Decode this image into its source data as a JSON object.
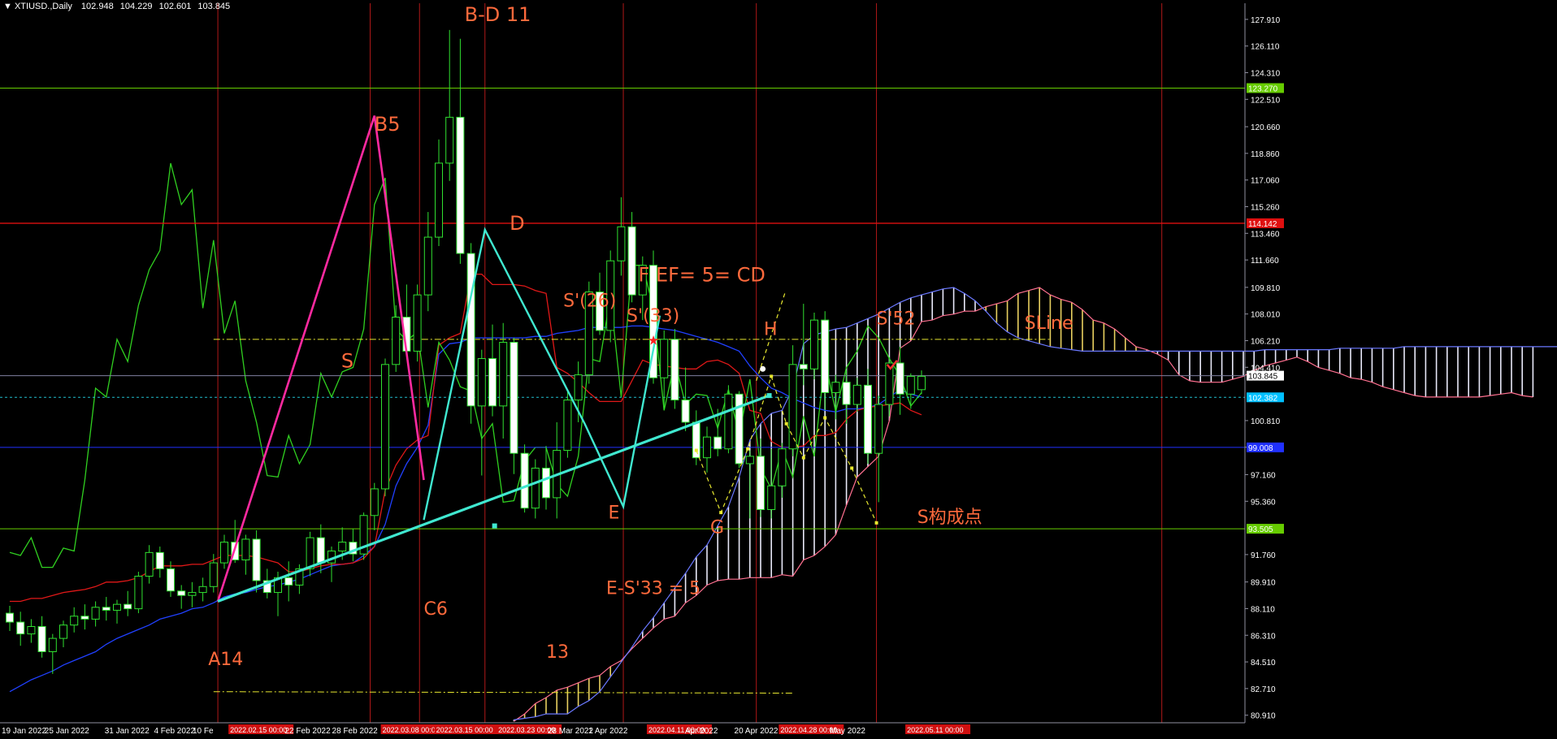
{
  "header": {
    "symbol": "XTIUSD.,Daily",
    "open": "102.948",
    "high": "104.229",
    "low": "102.601",
    "close": "103.845"
  },
  "chart_data": {
    "type": "candlestick",
    "symbol": "XTIUSD.",
    "timeframe": "Daily",
    "ylim": [
      80.4,
      129.0
    ],
    "y_ticks": [
      "127.910",
      "126.110",
      "124.310",
      "122.510",
      "120.660",
      "118.860",
      "117.060",
      "115.260",
      "113.460",
      "111.660",
      "109.810",
      "108.010",
      "106.210",
      "104.410",
      "103.845",
      "102.382",
      "100.810",
      "99.010",
      "97.160",
      "95.360",
      "93.505",
      "91.760",
      "89.910",
      "88.110",
      "86.310",
      "84.510",
      "82.710",
      "80.910"
    ],
    "x_labels": [
      "19 Jan 2022",
      "25 Jan 2022",
      "31 Jan 2022",
      "4 Feb 2022",
      "10 Fe",
      "2022.02.15 00:00",
      "22 Feb 2022",
      "28 Feb 2022",
      "2022.03.08 00:00",
      "2022.03.15 00:00",
      "2022.03.23 00:00",
      "28 Mar 2022",
      "1 Apr 2022",
      "2022.04.11 00:00",
      "Apr 2022",
      "20 Apr 2022",
      "2022.04.28 00:00",
      "May 2022",
      "2022.05.11 00:00"
    ],
    "x_label_kinds": [
      "axis",
      "axis",
      "axis",
      "axis",
      "axis",
      "marker",
      "axis",
      "axis",
      "marker",
      "marker",
      "marker",
      "axis",
      "axis",
      "marker",
      "axis",
      "axis",
      "marker",
      "axis",
      "marker"
    ],
    "price_tags": [
      {
        "label": "123.270",
        "value": 123.27,
        "color": "#66cc00"
      },
      {
        "label": "114.142",
        "value": 114.14,
        "color": "#e01010"
      },
      {
        "label": "103.845",
        "value": 103.845,
        "color": "#ffffff"
      },
      {
        "label": "102.382",
        "value": 102.38,
        "color": "#00c0ff"
      },
      {
        "label": "99.008",
        "value": 99.0,
        "color": "#2030ff"
      },
      {
        "label": "93.505",
        "value": 93.5,
        "color": "#66cc00"
      }
    ],
    "candles": [
      [
        87.8,
        88.3,
        86.6,
        87.2
      ],
      [
        87.2,
        87.9,
        85.6,
        86.4
      ],
      [
        86.4,
        87.4,
        85.8,
        86.9
      ],
      [
        86.9,
        87.6,
        84.8,
        85.2
      ],
      [
        85.2,
        86.4,
        83.7,
        86.1
      ],
      [
        86.1,
        87.3,
        85.5,
        87.0
      ],
      [
        87.0,
        88.2,
        86.5,
        87.6
      ],
      [
        87.6,
        88.4,
        86.7,
        87.4
      ],
      [
        87.4,
        88.6,
        86.9,
        88.2
      ],
      [
        88.2,
        88.9,
        87.3,
        88.0
      ],
      [
        88.0,
        88.7,
        87.1,
        88.4
      ],
      [
        88.4,
        89.3,
        87.6,
        88.1
      ],
      [
        88.1,
        90.6,
        87.8,
        90.3
      ],
      [
        90.3,
        92.4,
        89.8,
        91.9
      ],
      [
        91.9,
        92.3,
        90.2,
        90.8
      ],
      [
        90.8,
        91.3,
        88.9,
        89.3
      ],
      [
        89.3,
        89.7,
        88.1,
        89.0
      ],
      [
        89.0,
        89.9,
        88.2,
        89.2
      ],
      [
        89.2,
        90.2,
        88.6,
        89.6
      ],
      [
        89.6,
        91.8,
        89.2,
        91.2
      ],
      [
        91.2,
        93.1,
        90.8,
        92.6
      ],
      [
        92.6,
        94.1,
        91.2,
        91.4
      ],
      [
        91.4,
        93.1,
        90.4,
        92.8
      ],
      [
        92.8,
        93.4,
        89.2,
        90.0
      ],
      [
        90.0,
        90.8,
        88.8,
        89.2
      ],
      [
        89.2,
        90.6,
        87.6,
        90.2
      ],
      [
        90.2,
        91.3,
        88.6,
        89.7
      ],
      [
        89.7,
        91.1,
        89.1,
        90.8
      ],
      [
        90.8,
        93.3,
        90.3,
        92.9
      ],
      [
        92.9,
        93.8,
        90.5,
        91.2
      ],
      [
        91.2,
        92.3,
        89.9,
        92.0
      ],
      [
        92.0,
        93.6,
        91.4,
        92.6
      ],
      [
        92.6,
        93.5,
        91.3,
        91.8
      ],
      [
        91.8,
        94.6,
        91.4,
        94.4
      ],
      [
        94.4,
        96.6,
        93.4,
        96.2
      ],
      [
        96.2,
        105.0,
        95.7,
        104.6
      ],
      [
        104.6,
        108.6,
        104.1,
        107.8
      ],
      [
        107.8,
        110.0,
        105.2,
        105.5
      ],
      [
        105.5,
        110.0,
        104.8,
        109.3
      ],
      [
        109.3,
        114.9,
        108.2,
        113.2
      ],
      [
        113.2,
        119.8,
        112.6,
        118.2
      ],
      [
        118.2,
        127.2,
        117.0,
        121.3
      ],
      [
        121.3,
        126.6,
        111.4,
        112.1
      ],
      [
        112.1,
        112.8,
        100.6,
        101.8
      ],
      [
        101.8,
        105.6,
        97.1,
        105.0
      ],
      [
        105.0,
        107.3,
        101.1,
        101.8
      ],
      [
        101.8,
        107.4,
        99.6,
        106.1
      ],
      [
        106.1,
        106.4,
        97.2,
        98.6
      ],
      [
        98.6,
        99.2,
        94.6,
        94.9
      ],
      [
        94.9,
        98.2,
        94.2,
        97.6
      ],
      [
        97.6,
        99.1,
        94.8,
        95.6
      ],
      [
        95.6,
        100.7,
        94.2,
        98.8
      ],
      [
        98.8,
        102.9,
        98.3,
        102.2
      ],
      [
        102.2,
        104.8,
        100.7,
        103.9
      ],
      [
        103.9,
        110.2,
        103.3,
        109.5
      ],
      [
        109.5,
        110.8,
        106.6,
        106.9
      ],
      [
        106.9,
        112.3,
        106.1,
        111.6
      ],
      [
        111.6,
        115.9,
        110.6,
        113.9
      ],
      [
        113.9,
        114.9,
        108.8,
        109.3
      ],
      [
        109.3,
        111.9,
        107.6,
        111.3
      ],
      [
        111.3,
        112.3,
        103.3,
        103.7
      ],
      [
        103.7,
        106.9,
        101.6,
        106.3
      ],
      [
        106.3,
        107.0,
        101.6,
        102.2
      ],
      [
        102.2,
        104.4,
        100.1,
        100.7
      ],
      [
        100.7,
        101.5,
        97.8,
        98.3
      ],
      [
        98.3,
        100.4,
        97.3,
        99.7
      ],
      [
        99.7,
        101.6,
        98.4,
        98.9
      ],
      [
        98.9,
        103.2,
        98.6,
        102.6
      ],
      [
        102.6,
        102.8,
        97.6,
        97.9
      ],
      [
        97.9,
        98.8,
        94.2,
        98.4
      ],
      [
        98.4,
        99.6,
        94.3,
        94.8
      ],
      [
        94.8,
        98.9,
        94.2,
        96.4
      ],
      [
        96.4,
        99.3,
        95.6,
        98.9
      ],
      [
        98.9,
        105.9,
        98.4,
        104.6
      ],
      [
        104.6,
        108.7,
        103.2,
        104.3
      ],
      [
        104.3,
        108.1,
        103.6,
        107.6
      ],
      [
        107.6,
        108.2,
        101.5,
        102.7
      ],
      [
        102.7,
        103.9,
        100.9,
        103.4
      ],
      [
        103.4,
        104.2,
        100.6,
        101.9
      ],
      [
        101.9,
        103.7,
        101.4,
        103.2
      ],
      [
        103.2,
        104.3,
        97.9,
        98.6
      ],
      [
        98.6,
        102.5,
        95.3,
        101.9
      ],
      [
        101.9,
        105.1,
        101.1,
        104.7
      ],
      [
        104.7,
        105.8,
        101.2,
        102.6
      ],
      [
        102.6,
        104.0,
        101.6,
        103.8
      ],
      [
        102.9,
        104.2,
        102.6,
        103.8
      ]
    ],
    "tenkan": [
      88.6,
      88.6,
      88.8,
      88.8,
      89.0,
      89.2,
      89.3,
      89.4,
      89.6,
      89.9,
      89.9,
      90.0,
      90.2,
      90.6,
      91.0,
      91.0,
      91.0,
      91.1,
      91.1,
      91.4,
      91.7,
      91.7,
      91.7,
      91.6,
      91.4,
      91.2,
      90.6,
      90.6,
      90.8,
      91.0,
      91.1,
      91.1,
      91.2,
      91.5,
      92.3,
      96.1,
      97.8,
      98.9,
      99.5,
      99.8,
      105.9,
      106.4,
      106.7,
      110.7,
      110.7,
      110.0,
      110.0,
      110.0,
      109.9,
      109.6,
      109.4,
      104.4,
      104.0,
      103.4,
      102.7,
      102.1,
      102.1,
      102.1,
      103.5,
      104.9,
      104.6,
      104.5,
      104.4,
      104.3,
      104.3,
      104.8,
      104.9,
      104.6,
      104.0,
      101.5,
      101.3,
      99.4,
      99.0,
      99.0,
      99.1,
      99.8,
      99.8,
      100.0,
      100.9,
      101.5,
      101.7,
      101.8,
      101.9,
      102.0,
      101.5,
      101.2
    ],
    "kijun": [
      82.5,
      82.9,
      83.3,
      83.6,
      83.9,
      84.3,
      84.6,
      84.9,
      85.2,
      85.7,
      86.1,
      86.4,
      86.7,
      87.0,
      87.4,
      87.6,
      87.8,
      88.1,
      88.2,
      88.5,
      88.9,
      89.1,
      89.2,
      89.4,
      89.6,
      89.7,
      89.9,
      90.1,
      90.4,
      90.7,
      91.0,
      91.1,
      91.2,
      91.7,
      92.3,
      93.8,
      96.4,
      97.9,
      99.0,
      100.5,
      105.3,
      106.0,
      106.1,
      106.4,
      106.4,
      106.4,
      106.4,
      106.4,
      106.4,
      106.5,
      106.5,
      106.7,
      106.8,
      106.9,
      107.1,
      107.1,
      107.1,
      107.1,
      107.2,
      107.2,
      107.1,
      107.0,
      106.9,
      106.7,
      106.5,
      106.3,
      106.1,
      105.8,
      105.5,
      104.5,
      103.7,
      103.0,
      102.7,
      102.3,
      102.0,
      101.7,
      101.5,
      101.4,
      101.6,
      101.6,
      101.7,
      101.9,
      102.4,
      102.9,
      102.6,
      102.4
    ],
    "span_a": [
      null,
      null,
      null,
      null,
      null,
      null,
      null,
      null,
      null,
      null,
      null,
      null,
      null,
      null,
      null,
      null,
      null,
      null,
      null,
      null,
      null,
      null,
      null,
      null,
      null,
      null,
      null,
      null,
      null,
      null,
      null,
      null,
      null,
      null,
      null,
      null,
      null,
      null,
      null,
      null,
      null,
      null,
      null,
      null,
      null,
      null,
      null,
      80.5,
      81.0,
      81.7,
      82.1,
      82.6,
      82.8,
      83.1,
      83.4,
      83.6,
      84.2,
      84.6,
      85.4,
      86.1,
      86.8,
      87.4,
      87.6,
      88.5,
      89.0,
      89.7,
      90.0,
      90.1,
      90.1,
      90.2,
      90.2,
      90.2,
      90.4,
      90.3,
      91.4,
      91.7,
      92.3,
      93.1,
      95.1,
      97.0,
      97.7,
      98.4,
      100.8,
      105.7,
      106.2,
      107.5,
      107.6,
      107.9,
      108.0,
      108.2,
      108.2,
      108.5,
      108.7,
      108.9,
      109.4,
      109.6,
      109.8,
      109.3,
      109.0,
      108.8,
      108.3,
      107.6,
      107.4,
      107.0,
      106.4,
      105.8,
      105.6,
      105.3,
      104.9,
      103.9,
      103.5,
      103.4,
      103.4,
      103.4,
      103.6,
      103.8,
      104.2,
      104.5,
      104.7,
      104.9,
      105.1,
      104.8,
      104.4,
      104.2,
      104.0,
      103.7,
      103.6,
      103.4,
      103.1,
      102.9,
      102.7,
      102.5,
      102.4,
      102.4,
      102.4,
      102.4,
      102.4,
      102.4,
      102.5,
      102.6,
      102.7,
      102.5,
      102.4
    ],
    "span_b": [
      null,
      null,
      null,
      null,
      null,
      null,
      null,
      null,
      null,
      null,
      null,
      null,
      null,
      null,
      null,
      null,
      null,
      null,
      null,
      null,
      null,
      null,
      null,
      null,
      null,
      null,
      null,
      null,
      null,
      null,
      null,
      null,
      null,
      null,
      null,
      null,
      null,
      null,
      null,
      null,
      null,
      null,
      null,
      null,
      null,
      null,
      null,
      80.6,
      80.7,
      80.8,
      81.0,
      81.0,
      81.0,
      81.5,
      81.9,
      82.5,
      83.5,
      84.5,
      85.5,
      86.6,
      87.5,
      88.5,
      89.5,
      90.5,
      91.6,
      92.4,
      93.7,
      95.0,
      97.0,
      99.5,
      100.6,
      101.3,
      101.5,
      103.0,
      106.0,
      106.6,
      106.8,
      107.0,
      107.1,
      107.4,
      107.7,
      108.0,
      108.4,
      108.8,
      109.1,
      109.3,
      109.5,
      109.7,
      109.8,
      109.4,
      108.9,
      108.2,
      107.4,
      106.8,
      106.4,
      106.2,
      106.0,
      105.8,
      105.7,
      105.6,
      105.5,
      105.5,
      105.5,
      105.5,
      105.5,
      105.5,
      105.5,
      105.5,
      105.5,
      105.5,
      105.5,
      105.5,
      105.5,
      105.5,
      105.5,
      105.5,
      105.5,
      105.6,
      105.6,
      105.6,
      105.6,
      105.6,
      105.6,
      105.6,
      105.7,
      105.7,
      105.7,
      105.7,
      105.7,
      105.7,
      105.8,
      105.8,
      105.8,
      105.8,
      105.8,
      105.8,
      105.8,
      105.8,
      105.8,
      105.8,
      105.8,
      105.8,
      105.8,
      105.8,
      105.8,
      105.8
    ],
    "chikou": [
      91.9,
      91.7,
      92.9,
      90.9,
      90.9,
      92.2,
      92.0,
      96.8,
      103.0,
      102.4,
      106.3,
      104.8,
      108.6,
      111.0,
      112.3,
      118.2,
      115.4,
      116.4,
      108.4,
      113.0,
      106.7,
      108.9,
      103.5,
      100.7,
      97.1,
      97.0,
      99.8,
      97.9,
      99.2,
      104.0,
      102.4,
      104.1,
      104.4,
      107.0,
      115.4,
      117.2,
      107.0,
      106.2,
      106.8,
      101.7,
      106.1,
      104.9,
      103.1,
      102.8,
      99.6,
      100.6,
      95.3,
      95.4,
      98.1,
      99.0,
      99.0,
      96.5,
      95.7,
      98.4,
      105.0,
      104.8,
      109.2,
      102.4,
      111.3,
      111.3,
      108.4,
      101.5,
      104.8,
      101.9,
      102.6,
      102.5,
      100.3,
      102.9,
      99.8,
      103.6,
      97.6,
      96.2,
      98.9,
      97.0,
      101.1,
      98.4,
      104.9,
      101.4,
      104.4,
      105.5,
      107.2,
      106.4,
      105.0,
      103.8,
      101.8,
      102.7
    ],
    "annotations": [
      "B-D 11",
      "B5",
      "S",
      "D",
      "F  EF= 5= CD",
      "S'(26)",
      "S'(33)",
      "H",
      "S'52",
      "SLine",
      "E",
      "G",
      "S构成点",
      "C6",
      "E-S'33 = 5",
      "13",
      "A14"
    ]
  }
}
